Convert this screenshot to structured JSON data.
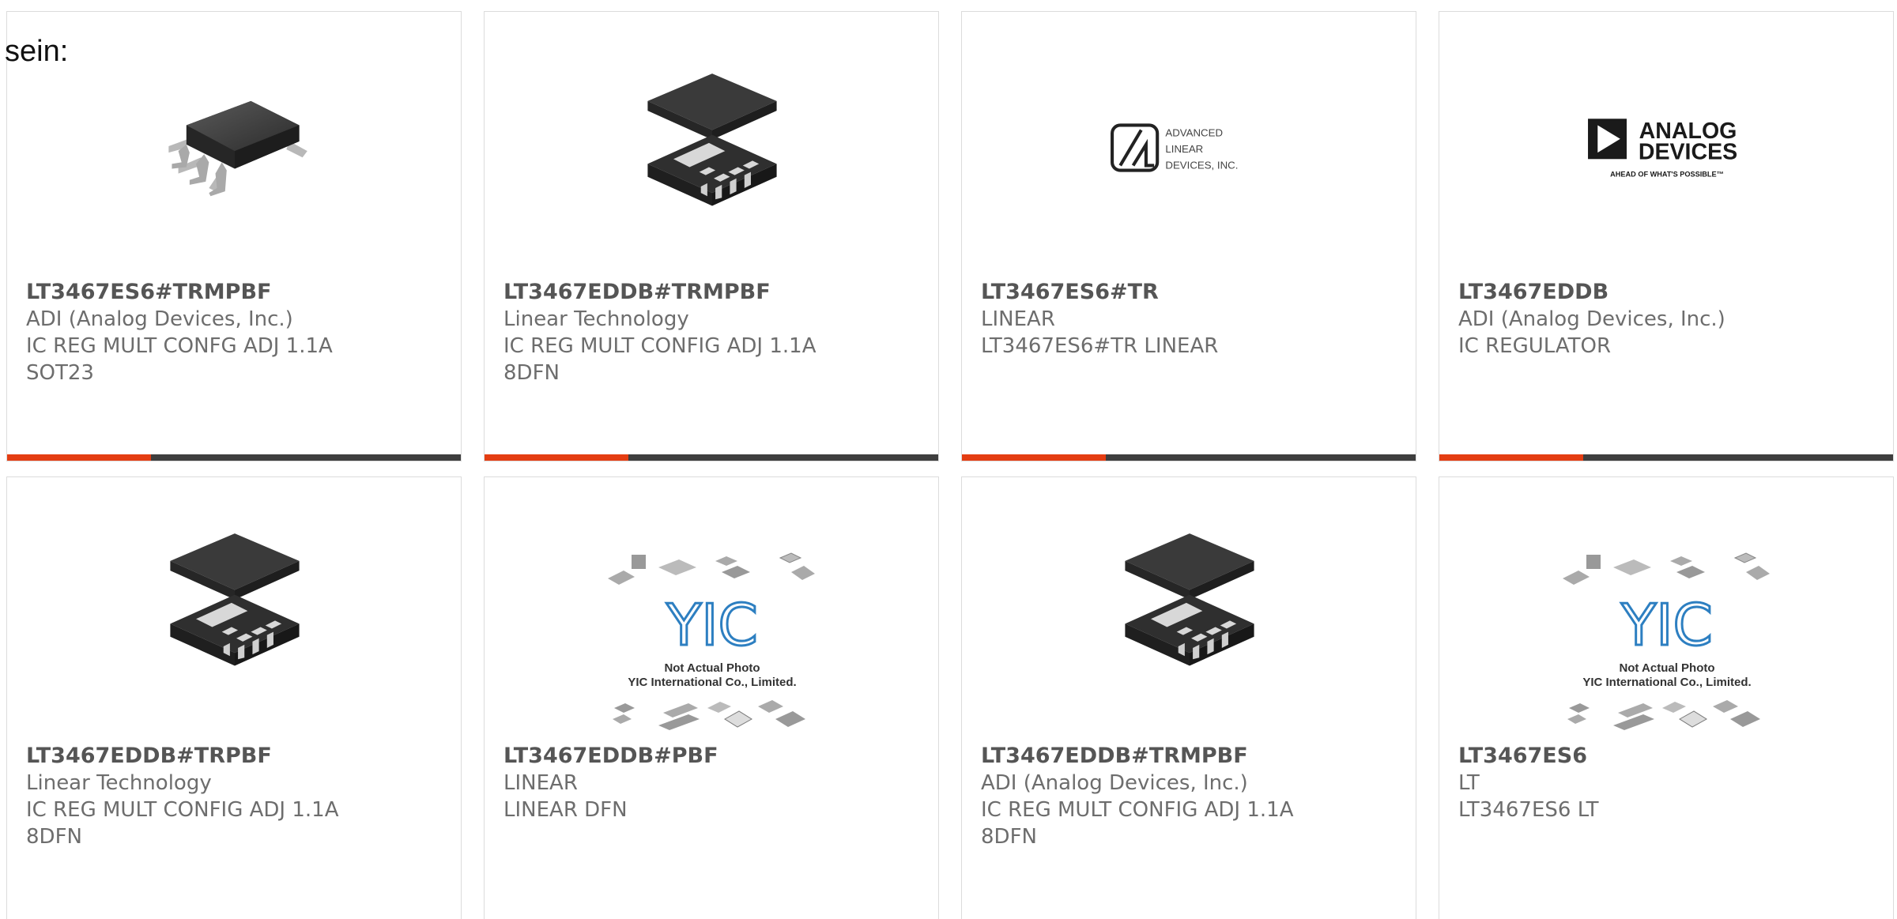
{
  "intro_text": "sein:",
  "colors": {
    "accent": "#e43d12",
    "bar_dark": "#3e3e3e",
    "part_number": "#555555",
    "text": "#6d6d6d",
    "border": "#dcdcdc"
  },
  "logos": {
    "advanced_linear": [
      "ADVANCED",
      "LINEAR",
      "DEVICES, INC."
    ],
    "analog_devices": [
      "ANALOG",
      "DEVICES",
      "AHEAD OF WHAT'S POSSIBLE™"
    ],
    "yic_caption": [
      "Not Actual Photo",
      "YIC International Co., Limited."
    ]
  },
  "products": [
    {
      "part_number": "LT3467ES6#TRMPBF",
      "manufacturer": "ADI (Analog Devices, Inc.)",
      "description": "IC REG MULT CONFG ADJ 1.1A",
      "package": "SOT23",
      "image": "sot23-package-photo"
    },
    {
      "part_number": "LT3467EDDB#TRMPBF",
      "manufacturer": "Linear Technology",
      "description": "IC REG MULT CONFIG ADJ 1.1A",
      "package": "8DFN",
      "image": "dfn-package-photo"
    },
    {
      "part_number": "LT3467ES6#TR",
      "manufacturer": "LINEAR",
      "description": "LT3467ES6#TR LINEAR",
      "package": "",
      "image": "advanced-linear-devices-logo"
    },
    {
      "part_number": "LT3467EDDB",
      "manufacturer": "ADI (Analog Devices, Inc.)",
      "description": "IC REGULATOR",
      "package": "",
      "image": "analog-devices-logo"
    },
    {
      "part_number": "LT3467EDDB#TRPBF",
      "manufacturer": "Linear Technology",
      "description": "IC REG MULT CONFIG ADJ 1.1A",
      "package": "8DFN",
      "image": "dfn-package-photo"
    },
    {
      "part_number": "LT3467EDDB#PBF",
      "manufacturer": "LINEAR",
      "description": "LINEAR DFN",
      "package": "",
      "image": "yic-placeholder-image"
    },
    {
      "part_number": "LT3467EDDB#TRMPBF",
      "manufacturer": "ADI (Analog Devices, Inc.)",
      "description": "IC REG MULT CONFIG ADJ 1.1A",
      "package": "8DFN",
      "image": "dfn-package-photo"
    },
    {
      "part_number": "LT3467ES6",
      "manufacturer": "LT",
      "description": "LT3467ES6 LT",
      "package": "",
      "image": "yic-placeholder-image"
    }
  ]
}
